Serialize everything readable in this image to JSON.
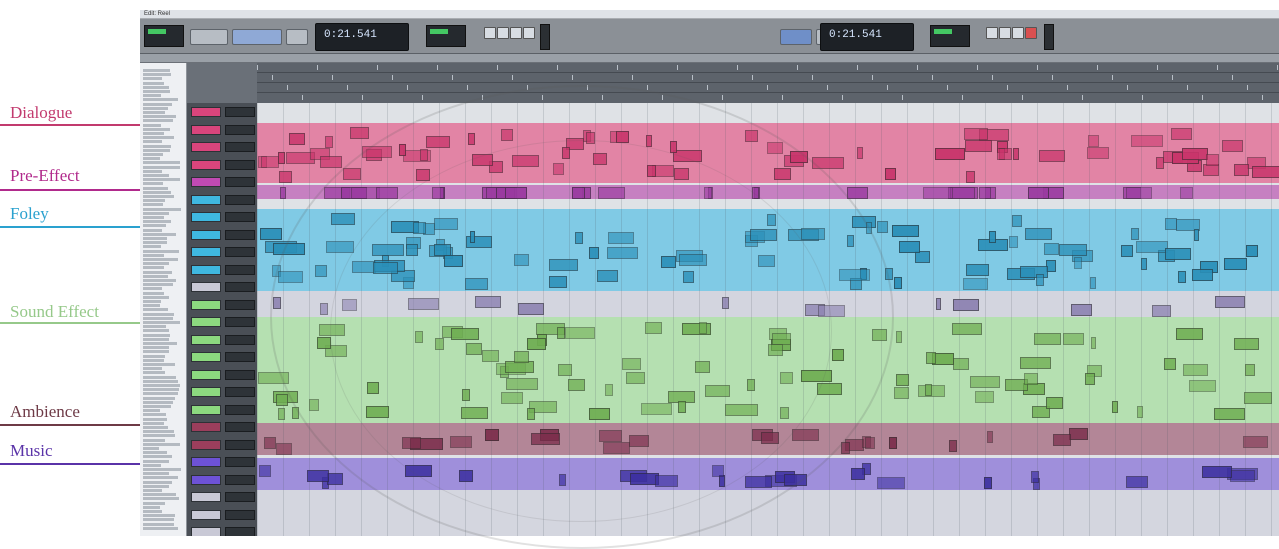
{
  "labels": [
    {
      "key": "dialogue",
      "text": "Dialogue",
      "color": "#c23a6e",
      "band_color": "#e3366f"
    },
    {
      "key": "pre_effect",
      "text": "Pre-Effect",
      "color": "#b12a8c",
      "band_color": "#b540a8"
    },
    {
      "key": "foley",
      "text": "Foley",
      "color": "#2aa1cf",
      "band_color": "#32b7e3"
    },
    {
      "key": "sound_effect",
      "text": "Sound Effect",
      "color": "#96c98a",
      "band_color": "#9ae08e"
    },
    {
      "key": "ambience",
      "text": "Ambience",
      "color": "#6e3a46",
      "band_color": "#8e3a56"
    },
    {
      "key": "music",
      "text": "Music",
      "color": "#5a33a8",
      "band_color": "#6a4bd1"
    }
  ],
  "window": {
    "title": "Edit: Reel",
    "counter_left": "0:21.541",
    "counter_right": "0:21.541"
  },
  "colors": {
    "toolbar": "#8b9096",
    "ruler": "#5d636b",
    "watermark": "#5a5a5a"
  }
}
